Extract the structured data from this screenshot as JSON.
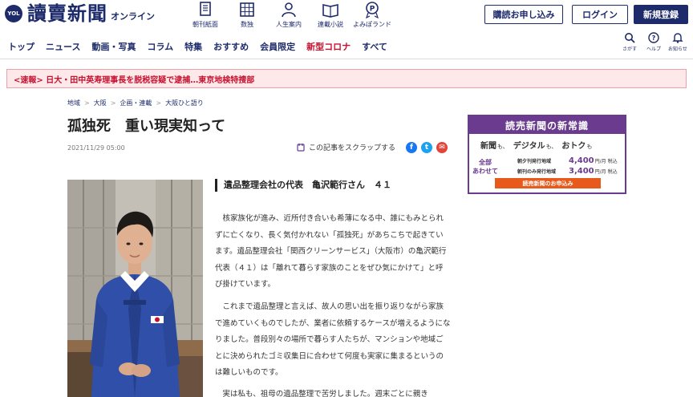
{
  "header": {
    "logo_mark": "YOL",
    "logo_name": "讀賣新聞",
    "logo_sub": "オンライン",
    "quick_links": [
      {
        "label": "朝刊紙面",
        "icon": "newspaper-icon"
      },
      {
        "label": "数独",
        "icon": "sudoku-grid-icon"
      },
      {
        "label": "人生案内",
        "icon": "person-icon"
      },
      {
        "label": "連載小説",
        "icon": "book-icon"
      },
      {
        "label": "よみぽランド",
        "icon": "points-icon"
      }
    ],
    "subscribe_label": "購読お申し込み",
    "login_label": "ログイン",
    "register_label": "新規登録"
  },
  "nav": {
    "items": [
      "トップ",
      "ニュース",
      "動画・写真",
      "コラム",
      "特集",
      "おすすめ",
      "会員限定",
      "新型コロナ",
      "すべて"
    ],
    "highlight_color": "#c8102e",
    "icons": [
      {
        "label": "さがす",
        "icon": "search-icon"
      },
      {
        "label": "ヘルプ",
        "icon": "help-icon"
      },
      {
        "label": "お知らせ",
        "icon": "bell-icon"
      }
    ]
  },
  "breaking": {
    "text": "<速報> 日大・田中英寿理事長を脱税容疑で逮捕…東京地検特捜部"
  },
  "breadcrumb": [
    "地域",
    "大阪",
    "企画・連載",
    "大阪ひと語り"
  ],
  "article": {
    "title": "孤独死　重い現実知って",
    "date": "2021/11/29 05:00",
    "scrap_label": "この記事をスクラップする",
    "share": [
      {
        "icon": "facebook-icon",
        "glyph": "f",
        "color": "#1877f2"
      },
      {
        "icon": "twitter-icon",
        "glyph": "t",
        "color": "#1da1f2"
      },
      {
        "icon": "mail-icon",
        "glyph": "✉",
        "color": "#e2453b"
      }
    ],
    "subhead": "遺品整理会社の代表　亀沢範行さん　４１",
    "paragraphs": [
      "核家族化が進み、近所付き合いも希薄になる中、誰にもみとられずに亡くなり、長く気付かれない「孤独死」があちこちで起きています。遺品整理会社「関西クリーンサービス」（大阪市）の亀沢範行代表（４１）は「離れて暮らす家族のことをぜひ気にかけて」と呼び掛けています。",
      "これまで遺品整理と言えば、故人の思い出を振り返りながら家族で進めていくものでしたが、業者に依頼するケースが増えるようになりました。普段別々の場所で暮らす人たちが、マンションや地域ごとに決められたゴミ収集日に合わせて何度も実家に集まるというのは難しいものです。",
      "実は私も、祖母の遺品整理で苦労しました。週末ごとに親き"
    ]
  },
  "ad": {
    "title": "読売新聞の新常識",
    "words": [
      {
        "word": "新聞",
        "particle": "も、"
      },
      {
        "word": "デジタル",
        "particle": "も、"
      },
      {
        "word": "おトク",
        "particle": "も"
      }
    ],
    "left_line1": "全部",
    "left_line2": "あわせて",
    "prices": [
      {
        "area": "朝夕刊発行地域",
        "amount": "4,400",
        "unit": "円/月 税込"
      },
      {
        "area": "朝刊のみ発行地域",
        "amount": "3,400",
        "unit": "円/月 税込"
      }
    ],
    "cta": "読売新聞のお申込み",
    "accent": "#6a3b8f",
    "cta_color": "#e85a1c"
  },
  "brand_color": "#1d2b6b"
}
